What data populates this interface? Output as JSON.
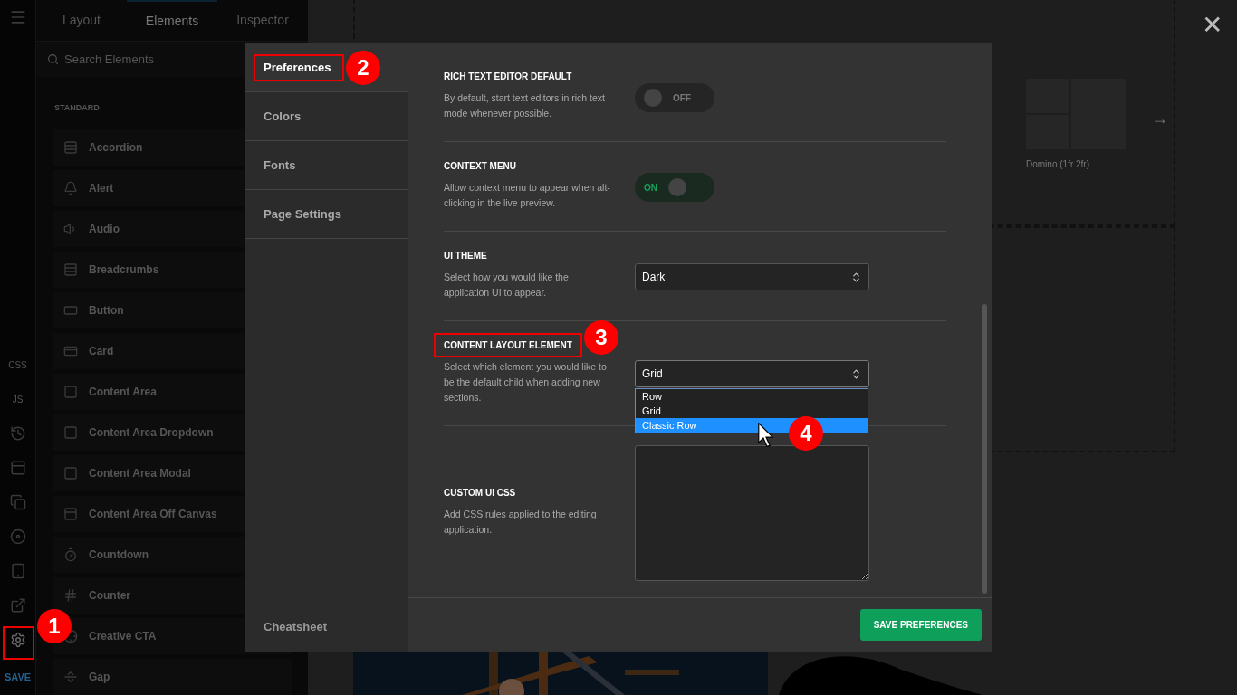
{
  "rail": {
    "items": [
      {
        "kind": "icon"
      },
      {
        "kind": "text",
        "label": "CSS"
      },
      {
        "kind": "text",
        "label": "JS"
      },
      {
        "kind": "icon"
      },
      {
        "kind": "icon"
      },
      {
        "kind": "icon"
      },
      {
        "kind": "icon"
      },
      {
        "kind": "icon"
      },
      {
        "kind": "icon"
      },
      {
        "kind": "icon"
      }
    ],
    "save": "SAVE"
  },
  "panel": {
    "tabs": [
      {
        "label": "Layout",
        "selected": false
      },
      {
        "label": "Elements",
        "selected": true
      },
      {
        "label": "Inspector",
        "selected": false
      }
    ],
    "search": {
      "placeholder": "Search Elements"
    },
    "heading": "STANDARD",
    "items": [
      "Accordion",
      "Alert",
      "Audio",
      "Breadcrumbs",
      "Button",
      "Card",
      "Content Area",
      "Content Area Dropdown",
      "Content Area Modal",
      "Content Area Off Canvas",
      "Countdown",
      "Counter",
      "Creative CTA",
      "Gap"
    ]
  },
  "canvas": {
    "layout_caption": "Domino (1fr 2fr)",
    "arrow": "→"
  },
  "modal": {
    "nav": [
      {
        "label": "Preferences",
        "selected": true
      },
      {
        "label": "Colors",
        "selected": false
      },
      {
        "label": "Fonts",
        "selected": false
      },
      {
        "label": "Page Settings",
        "selected": false
      }
    ],
    "nav_footer": "Cheatsheet",
    "settings": [
      {
        "kind": "toggle",
        "title": "RICH TEXT EDITOR DEFAULT",
        "description": "By default, start text editors in rich text mode whenever possible.",
        "on": false,
        "label": "OFF"
      },
      {
        "kind": "toggle",
        "title": "CONTEXT MENU",
        "description": "Allow context menu to appear when alt-clicking in the live preview.",
        "on": true,
        "label": "ON"
      },
      {
        "kind": "select",
        "title": "UI THEME",
        "description": "Select how you would like the application UI to appear.",
        "value": "Dark",
        "expanded": false
      },
      {
        "kind": "select",
        "title": "CONTENT LAYOUT ELEMENT",
        "description": "Select which element you would like to be the default child when adding new sections.",
        "value": "Grid",
        "expanded": true,
        "options": [
          {
            "label": "Row",
            "highlighted": false
          },
          {
            "label": "Grid",
            "highlighted": false
          },
          {
            "label": "Classic Row",
            "highlighted": true
          }
        ]
      },
      {
        "kind": "textarea",
        "title": "CUSTOM UI CSS",
        "description": "Add CSS rules applied to the editing application."
      }
    ],
    "save_button": "SAVE PREFERENCES",
    "close": "✕"
  },
  "annotations": [
    {
      "label": "1"
    },
    {
      "label": "2"
    },
    {
      "label": "3"
    },
    {
      "label": "4"
    }
  ]
}
